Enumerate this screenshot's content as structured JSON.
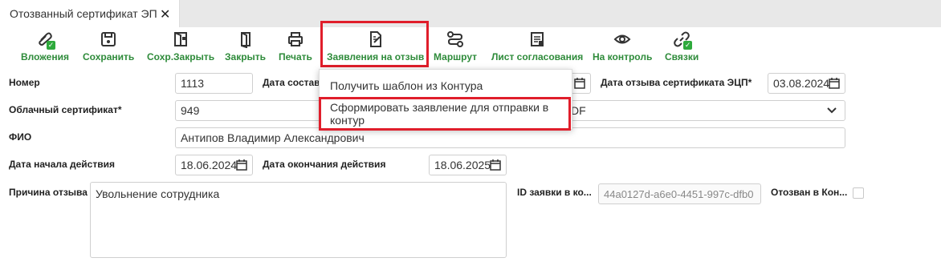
{
  "tab": {
    "title": "Отозванный сертификат ЭП",
    "close": "✕"
  },
  "toolbar": {
    "attachments": "Вложения",
    "save": "Сохранить",
    "save_close": "Сохр.Закрыть",
    "close": "Закрыть",
    "print": "Печать",
    "revoke_statements": "Заявления на отзыв",
    "route": "Маршрут",
    "approval_sheet": "Лист согласования",
    "on_control": "На контроль",
    "links": "Связки"
  },
  "dropdown": {
    "items": [
      "Получить шаблон из Контура",
      "Сформировать заявление для отправки в контур"
    ]
  },
  "form": {
    "number_label": "Номер",
    "number_value": "1113",
    "compile_date_label": "Дата составл",
    "revoke_date_label": "Дата отзыва сертификата ЭЦП*",
    "revoke_date_value": "03.08.2024",
    "cloud_cert_label": "Облачный сертификат*",
    "cloud_cert_value": "949",
    "cloud_cert_tail": "DF",
    "fio_label": "ФИО",
    "fio_value": "Антипов Владимир Александрович",
    "start_date_label": "Дата начала действия",
    "start_date_value": "18.06.2024",
    "end_date_label": "Дата окончания действия",
    "end_date_value": "18.06.2025",
    "reason_label": "Причина отзыва",
    "reason_value": "Увольнение сотрудника",
    "request_id_label": "ID заявки в ко...",
    "request_id_value": "44a0127d-a6e0-4451-997c-dfb0",
    "revoked_in_label": "Отозван в Кон..."
  },
  "colors": {
    "accent": "#2e8b3a",
    "highlight": "#e01e2b"
  }
}
